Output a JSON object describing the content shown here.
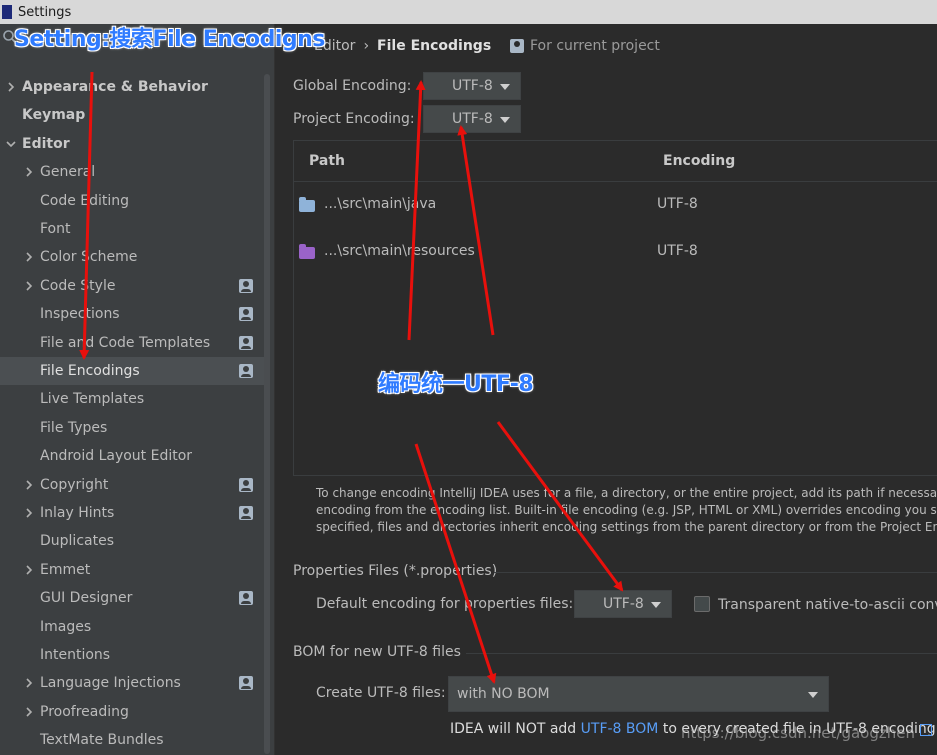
{
  "window": {
    "title": "Settings"
  },
  "sidebar": {
    "items": [
      {
        "label": "Appearance & Behavior",
        "level": 0,
        "bold": true,
        "expandable": true,
        "expanded": false,
        "project": false
      },
      {
        "label": "Keymap",
        "level": 0,
        "bold": true,
        "expandable": false,
        "project": false
      },
      {
        "label": "Editor",
        "level": 0,
        "bold": true,
        "expandable": true,
        "expanded": true,
        "project": false
      },
      {
        "label": "General",
        "level": 1,
        "expandable": true,
        "project": false
      },
      {
        "label": "Code Editing",
        "level": 1,
        "expandable": false,
        "project": false
      },
      {
        "label": "Font",
        "level": 1,
        "expandable": false,
        "project": false
      },
      {
        "label": "Color Scheme",
        "level": 1,
        "expandable": true,
        "project": false
      },
      {
        "label": "Code Style",
        "level": 1,
        "expandable": true,
        "project": true
      },
      {
        "label": "Inspections",
        "level": 1,
        "expandable": false,
        "project": true
      },
      {
        "label": "File and Code Templates",
        "level": 1,
        "expandable": false,
        "project": true
      },
      {
        "label": "File Encodings",
        "level": 1,
        "expandable": false,
        "project": true,
        "selected": true
      },
      {
        "label": "Live Templates",
        "level": 1,
        "expandable": false,
        "project": false
      },
      {
        "label": "File Types",
        "level": 1,
        "expandable": false,
        "project": false
      },
      {
        "label": "Android Layout Editor",
        "level": 1,
        "expandable": false,
        "project": false
      },
      {
        "label": "Copyright",
        "level": 1,
        "expandable": true,
        "project": true
      },
      {
        "label": "Inlay Hints",
        "level": 1,
        "expandable": true,
        "project": true
      },
      {
        "label": "Duplicates",
        "level": 1,
        "expandable": false,
        "project": false
      },
      {
        "label": "Emmet",
        "level": 1,
        "expandable": true,
        "project": false
      },
      {
        "label": "GUI Designer",
        "level": 1,
        "expandable": false,
        "project": true
      },
      {
        "label": "Images",
        "level": 1,
        "expandable": false,
        "project": false
      },
      {
        "label": "Intentions",
        "level": 1,
        "expandable": false,
        "project": false
      },
      {
        "label": "Language Injections",
        "level": 1,
        "expandable": true,
        "project": true
      },
      {
        "label": "Proofreading",
        "level": 1,
        "expandable": true,
        "project": false
      },
      {
        "label": "TextMate Bundles",
        "level": 1,
        "expandable": false,
        "project": false
      }
    ]
  },
  "main": {
    "breadcrumb": {
      "parent": "Editor",
      "current": "File Encodings"
    },
    "for_project": "For current project",
    "global_encoding": {
      "label": "Global Encoding:",
      "value": "UTF-8"
    },
    "project_encoding": {
      "label": "Project Encoding:",
      "value": "UTF-8"
    },
    "table": {
      "columns": [
        "Path",
        "Encoding"
      ],
      "rows": [
        {
          "path": "...\\src\\main\\java",
          "encoding": "UTF-8",
          "icon": "folder-icon"
        },
        {
          "path": "...\\src\\main\\resources",
          "encoding": "UTF-8",
          "icon": "resources-folder-icon"
        }
      ]
    },
    "help": [
      "To change encoding IntelliJ IDEA uses for a file, a directory, or the entire project, add its path if necessary",
      "encoding from the encoding list. Built-in file encoding (e.g. JSP, HTML or XML) overrides encoding you s",
      "specified, files and directories inherit encoding settings from the parent directory or from the Project Enc"
    ],
    "properties": {
      "section": "Properties Files (*.properties)",
      "label": "Default encoding for properties files:",
      "value": "UTF-8",
      "checkbox_label": "Transparent native-to-ascii conve"
    },
    "bom": {
      "section": "BOM for new UTF-8 files",
      "label": "Create UTF-8 files:",
      "value": "with NO BOM",
      "info_prefix": "IDEA will NOT add ",
      "info_link": "UTF-8 BOM",
      "info_suffix": " to every created file in UTF-8 encoding"
    }
  },
  "annotations": {
    "title": "Setting:搜索File Encodigns",
    "middle": "编码统一UTF-8",
    "color": "#2f7bff",
    "arrow_color": "#e8100c"
  },
  "watermark": "https://blog.csdn.net/gaogzhen"
}
